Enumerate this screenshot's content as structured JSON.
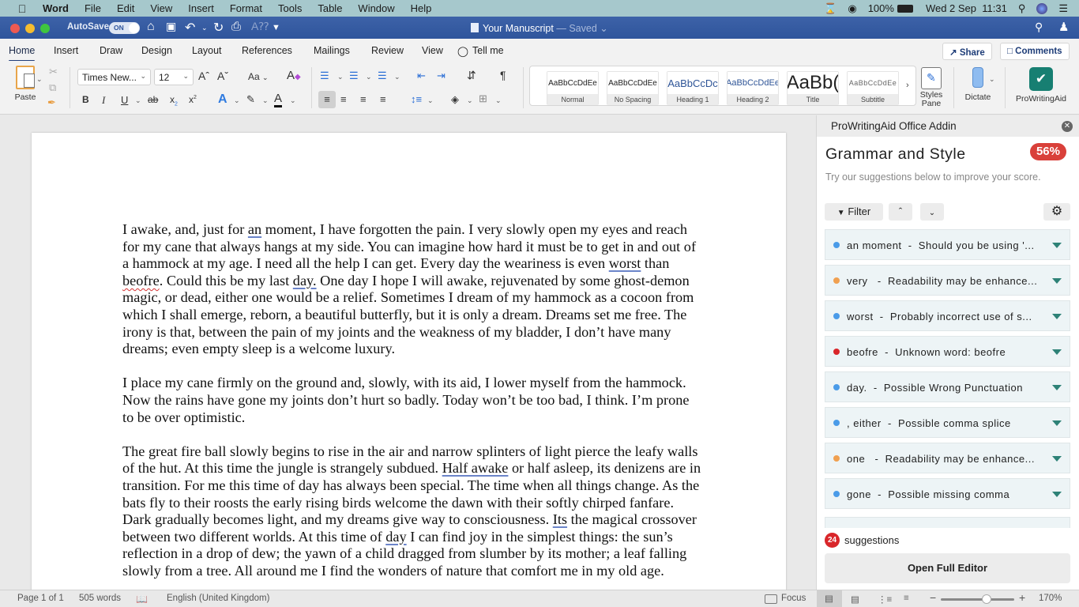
{
  "menubar": {
    "app": "Word",
    "items": [
      "File",
      "Edit",
      "View",
      "Insert",
      "Format",
      "Tools",
      "Table",
      "Window",
      "Help"
    ],
    "battery": "100%",
    "datetime": "Wed 2 Sep  11:31"
  },
  "titlebar": {
    "autosave_label": "AutoSave",
    "autosave_state": "ON",
    "document_name": "Your Manuscript",
    "save_status": "— Saved"
  },
  "tabs": {
    "items": [
      "Home",
      "Insert",
      "Draw",
      "Design",
      "Layout",
      "References",
      "Mailings",
      "Review",
      "View"
    ],
    "active": "Home",
    "tell_me": "Tell me",
    "share": "Share",
    "comments": "Comments"
  },
  "ribbon": {
    "paste": "Paste",
    "font_name": "Times New...",
    "font_size": "12",
    "change_case": "Aa",
    "styles": [
      {
        "preview": "AaBbCcDdEe",
        "label": "Normal"
      },
      {
        "preview": "AaBbCcDdEe",
        "label": "No Spacing"
      },
      {
        "preview": "AaBbCcDc",
        "label": "Heading 1"
      },
      {
        "preview": "AaBbCcDdEe",
        "label": "Heading 2"
      },
      {
        "preview": "AaBb(",
        "label": "Title"
      },
      {
        "preview": "AaBbCcDdEe",
        "label": "Subtitle"
      }
    ],
    "styles_pane": "Styles Pane",
    "dictate": "Dictate",
    "prowritingaid": "ProWritingAid"
  },
  "document": {
    "paragraphs": [
      [
        {
          "t": "I awake, and, just for "
        },
        {
          "t": "an",
          "u": "blue"
        },
        {
          "t": " moment, I have forgotten the pain. I very slowly open my eyes and reach for my cane that always hangs at my side. You can imagine how hard it must be to get in and out of a hammock at my age. I need all the help I can get. Every day the weariness is even "
        },
        {
          "t": "worst",
          "u": "blue"
        },
        {
          "t": " than "
        },
        {
          "t": "beofre",
          "u": "red"
        },
        {
          "t": ". Could this be my last "
        },
        {
          "t": "day.",
          "u": "blue"
        },
        {
          "t": " One day I hope I will awake, rejuvenated by some ghost-demon magic, or dead, either one would be a relief. Sometimes I dream of my hammock as a cocoon from which I shall emerge, reborn, a beautiful butterfly, but it is only a dream. Dreams set me free. The irony is that, between the pain of my joints and the weakness of my bladder, I don’t have many dreams; even empty sleep is a welcome luxury."
        }
      ],
      [
        {
          "t": "I place my cane firmly on the ground and, slowly, with its aid, I lower myself from the hammock. Now the rains have gone my joints don’t hurt so badly. Today won’t be too bad, I think. I’m prone to be over optimistic."
        }
      ],
      [
        {
          "t": "The great fire ball slowly begins to rise in the air and narrow splinters of light pierce the leafy walls of the hut. At this time the jungle is strangely subdued. "
        },
        {
          "t": "Half awake",
          "u": "blue"
        },
        {
          "t": " or half asleep, its denizens are in transition. For me this time of day has always been special. The time when all things change. As the bats fly to their roosts the early rising birds welcome the dawn with their softly chirped fanfare. Dark gradually becomes light, and my dreams give way to consciousness. "
        },
        {
          "t": "Its",
          "u": "blue"
        },
        {
          "t": " the magical crossover between two different worlds. At this time of "
        },
        {
          "t": "day",
          "u": "blue"
        },
        {
          "t": " I can find joy in the simplest things: the sun’s reflection in a drop of dew; the yawn of a child dragged from slumber by its mother; a leaf falling slowly from a tree. All around me I find the wonders of nature that comfort me in my old age."
        }
      ]
    ]
  },
  "panel": {
    "header": "ProWritingAid Office Addin",
    "title": "Grammar and Style",
    "score": "56%",
    "subtitle": "Try our suggestions below to improve your score.",
    "filter": "Filter",
    "suggestions": [
      {
        "text": "an moment  -  Should you be using '...",
        "color": "#4a9be8"
      },
      {
        "text": "very   -  Readability may be enhance...",
        "color": "#f0a050"
      },
      {
        "text": "worst  -  Probably incorrect use of s...",
        "color": "#4a9be8"
      },
      {
        "text": "beofre  -  Unknown word: beofre",
        "color": "#d9262a"
      },
      {
        "text": "day.  -  Possible Wrong Punctuation",
        "color": "#4a9be8"
      },
      {
        "text": ", either  -  Possible comma splice",
        "color": "#4a9be8"
      },
      {
        "text": "one   -  Readability may be enhance...",
        "color": "#f0a050"
      },
      {
        "text": "gone  -  Possible missing comma",
        "color": "#4a9be8"
      }
    ],
    "suggestion_count": "24",
    "suggestion_label": "suggestions",
    "open_full_editor": "Open Full Editor"
  },
  "status": {
    "page": "Page 1 of 1",
    "words": "505 words",
    "language": "English (United Kingdom)",
    "focus": "Focus",
    "zoom": "170%",
    "zoom_fraction": 0.62
  }
}
